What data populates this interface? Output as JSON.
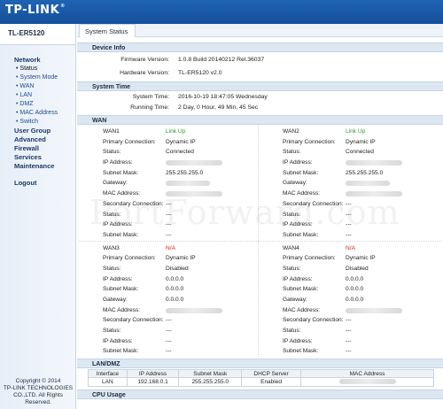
{
  "brand": {
    "logo": "TP-LINK",
    "reg": "®"
  },
  "sidebar": {
    "model": "TL-ER5120",
    "network_label": "Network",
    "network_items": [
      "• Status",
      "• System Mode",
      "• WAN",
      "• LAN",
      "• DMZ",
      "• MAC Address",
      "• Switch"
    ],
    "groups": [
      "User Group",
      "Advanced",
      "Firewall",
      "Services",
      "Maintenance"
    ],
    "logout": "Logout",
    "copyright": [
      "Copyright © 2014",
      "TP-LINK TECHNOLOGIES",
      "CO.,LTD. All Rights",
      "Reserved."
    ]
  },
  "tab": {
    "label": "System Status"
  },
  "device_info": {
    "title": "Device Info",
    "firmware_label": "Firmware Version:",
    "firmware_value": "1.0.8 Build 20140212 Rel.36037",
    "hardware_label": "Hardware Version:",
    "hardware_value": "TL-ER5120 v2.0"
  },
  "system_time": {
    "title": "System Time",
    "time_label": "System Time:",
    "time_value": "2016-10-19 18:47:05 Wednesday",
    "running_label": "Running Time:",
    "running_value": "2 Day, 0 Hour, 49 Min, 45 Sec"
  },
  "wan": {
    "title": "WAN",
    "labels": {
      "primary": "Primary Connection:",
      "status": "Status:",
      "ip": "IP Address:",
      "mask": "Subnet Mask:",
      "gateway": "Gateway:",
      "mac": "MAC Address:",
      "secondary": "Secondary Connection:"
    },
    "ports": [
      {
        "name": "WAN1",
        "link": "Link Up",
        "link_color": "#2f9a2f",
        "primary": "Dynamic IP",
        "status": "Connected",
        "mask": "255.255.255.0",
        "secondary": "---",
        "sec_status": "---",
        "sec_ip": "---",
        "sec_mask": "---"
      },
      {
        "name": "WAN2",
        "link": "Link Up",
        "link_color": "#2f9a2f",
        "primary": "Dynamic IP",
        "status": "Connected",
        "mask": "255.255.255.0",
        "secondary": "---",
        "sec_status": "---",
        "sec_ip": "---",
        "sec_mask": "---"
      },
      {
        "name": "WAN3",
        "link": "N/A",
        "link_color": "#d22222",
        "primary": "Dynamic IP",
        "status": "Disabled",
        "ip": "0.0.0.0",
        "mask": "0.0.0.0",
        "gateway": "0.0.0.0",
        "secondary": "---",
        "sec_status": "---",
        "sec_ip": "---",
        "sec_mask": "---"
      },
      {
        "name": "WAN4",
        "link": "N/A",
        "link_color": "#d22222",
        "primary": "Dynamic IP",
        "status": "Disabled",
        "ip": "0.0.0.0",
        "mask": "0.0.0.0",
        "gateway": "0.0.0.0",
        "secondary": "---",
        "sec_status": "---",
        "sec_ip": "---",
        "sec_mask": "---"
      }
    ]
  },
  "lan": {
    "title": "LAN/DMZ",
    "headers": [
      "Interface",
      "IP Address",
      "Subnet Mask",
      "DHCP Server",
      "MAC Address"
    ],
    "row": [
      "LAN",
      "192.168.0.1",
      "255.255.255.0",
      "Enabled",
      ""
    ]
  },
  "cpu": {
    "title": "CPU Usage"
  },
  "watermark": "PortForward.com"
}
